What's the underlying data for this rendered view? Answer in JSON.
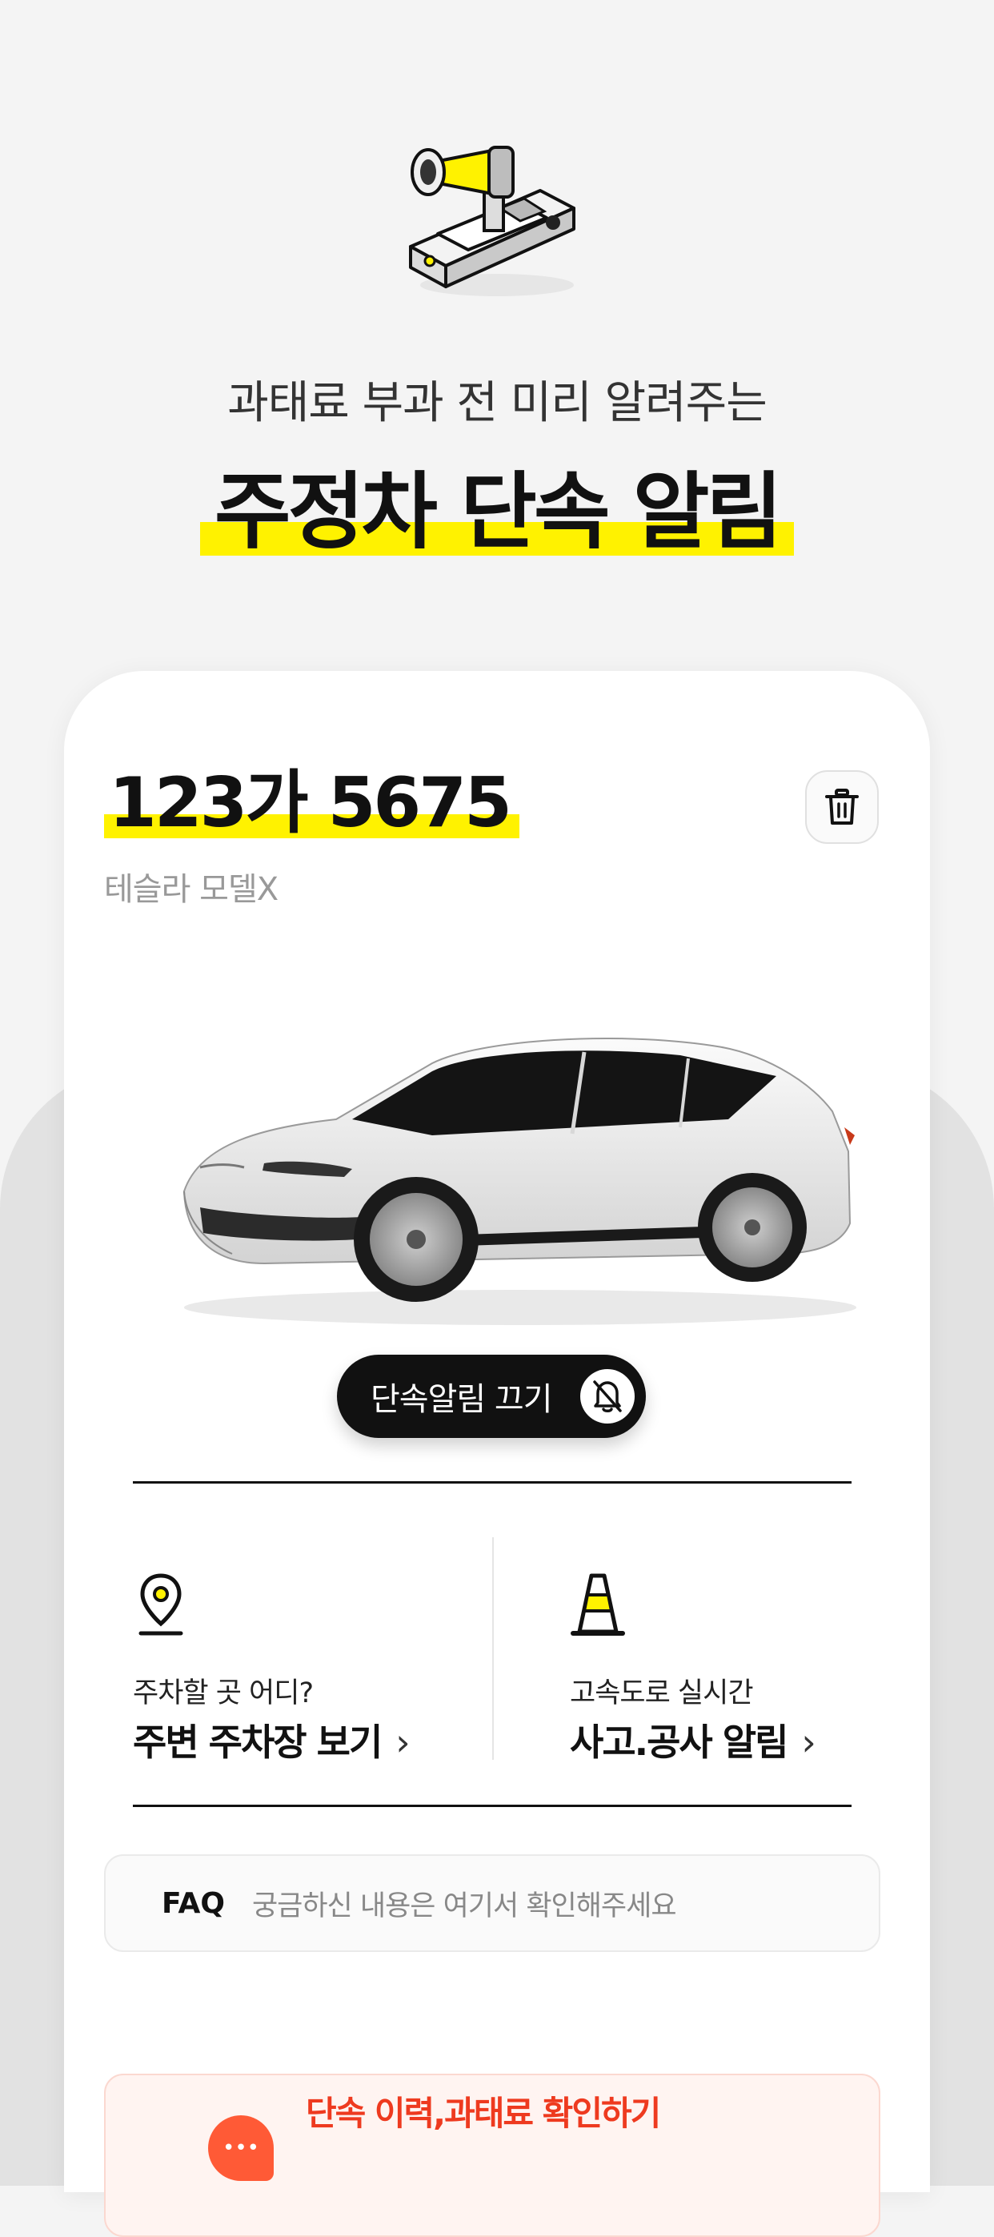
{
  "hero": {
    "subtitle": "과태료 부과 전 미리 알려주는",
    "title": "주정차 단속 알림",
    "highlight_color": "#fff200",
    "icon": "megaphone-car-icon"
  },
  "vehicle": {
    "plate": "123가 5675",
    "model": "테슬라 모델X",
    "image": "white-tesla-model-x-image"
  },
  "alert_toggle": {
    "label": "단속알림 끄기",
    "icon": "bell-off-icon"
  },
  "quick_links": [
    {
      "icon": "location-pin-icon",
      "sub": "주차할 곳 어디?",
      "main": "주변 주차장 보기"
    },
    {
      "icon": "traffic-cone-icon",
      "sub": "고속도로 실시간",
      "main": "사고.공사 알림"
    }
  ],
  "faq": {
    "tag": "FAQ",
    "text": "궁금하신 내용은 여기서 확인해주세요"
  },
  "history": {
    "title": "단속 이력,과태료 확인하기",
    "accent_color": "#ff5a36"
  }
}
